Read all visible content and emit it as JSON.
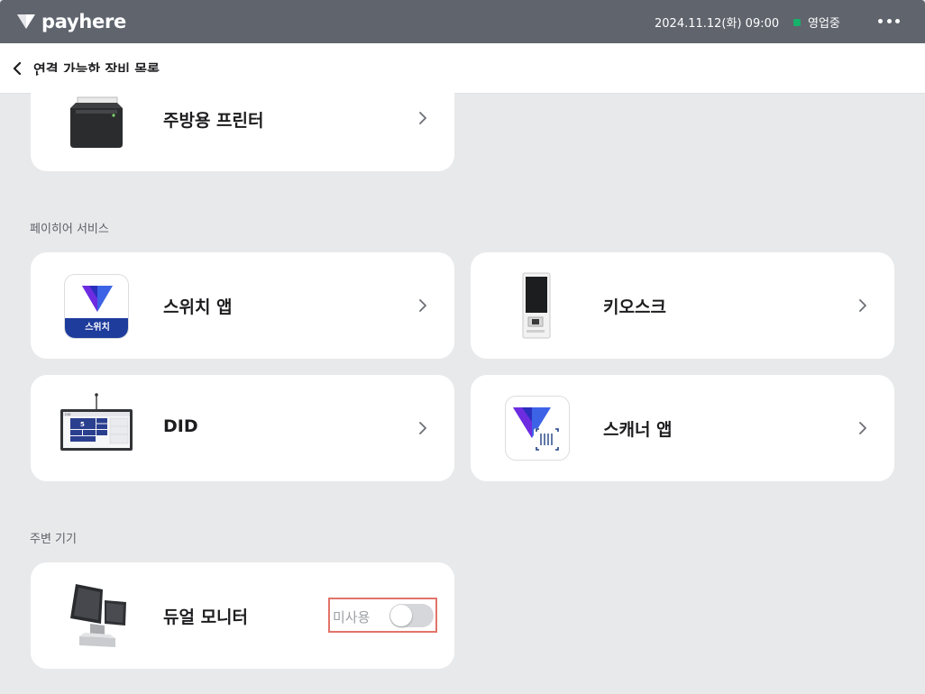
{
  "brand": {
    "name": "payhere"
  },
  "header": {
    "datetime": "2024.11.12(화) 09:00",
    "status_label": "영업중"
  },
  "subheader": {
    "title": "연결 가능한 장비 목록"
  },
  "devices": {
    "kitchen_printer": "주방용 프린터"
  },
  "sections": {
    "payhere": {
      "label": "페이히어 서비스",
      "items": [
        "스위치 앱",
        "키오스크",
        "DID",
        "스캐너 앱"
      ],
      "switch_badge": "스위치"
    },
    "peripheral": {
      "label": "주변 기기",
      "dual_monitor": "듀얼 모니터",
      "toggle_label": "미사용",
      "toggle_on": false
    }
  },
  "did_screen": {
    "header": "DID",
    "number": "5"
  },
  "colors": {
    "topbar": "#5f646d",
    "status": "#17b26a",
    "highlight": "#e2736a",
    "background": "#e8e9eb"
  }
}
